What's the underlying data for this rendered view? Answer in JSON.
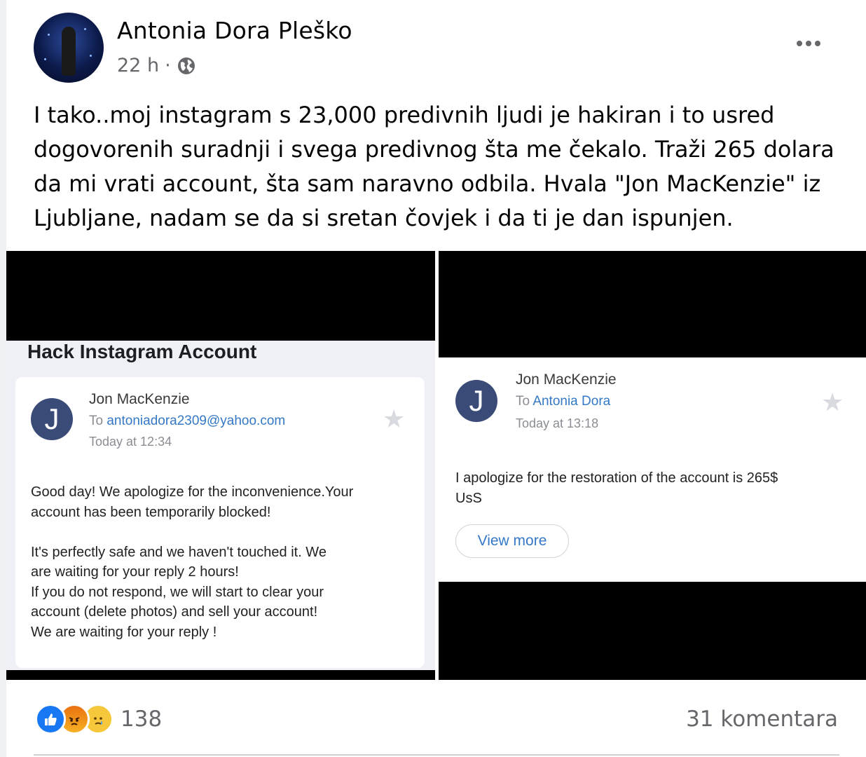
{
  "post": {
    "author": "Antonia Dora Pleško",
    "time": "22 h",
    "separator": "·",
    "privacy_icon": "globe-icon",
    "more_icon": "more-options-icon",
    "text": "I tako..moj instagram s 23,000 predivnih ljudi je hakiran i to usred dogovorenih suradnji i svega predivnog šta me čekalo. Traži 265 dolara da mi vrati account, šta sam naravno odbila. Hvala \"Jon MacKenzie\" iz Ljubljane, nadam se da si sretan čovjek i da ti je dan ispunjen."
  },
  "photo_left": {
    "heading": "Hack Instagram Account",
    "avatar_letter": "J",
    "sender": "Jon MacKenzie",
    "to_prefix": "To",
    "to": "antoniadora2309@yahoo.com",
    "time": "Today at 12:34",
    "message": "Good day! We apologize for the inconvenience.Your\naccount has been temporarily blocked!\n\n It's perfectly safe and we haven't touched it. We\nare waiting for your reply 2 hours!\nIf you do not respond, we will start to clear your\naccount (delete photos) and sell your account!\nWe are waiting for your reply !"
  },
  "photo_right": {
    "avatar_letter": "J",
    "sender": "Jon MacKenzie",
    "to_prefix": "To",
    "to": "Antonia Dora",
    "time": "Today at 13:18",
    "message": "I apologize for the restoration of the account is 265$\nUsS",
    "view_more": "View more"
  },
  "footer": {
    "reaction_count": "138",
    "comments": "31 komentara"
  },
  "colors": {
    "like": "#1877f2",
    "link": "#3478c6",
    "secondary_text": "#65676b"
  }
}
